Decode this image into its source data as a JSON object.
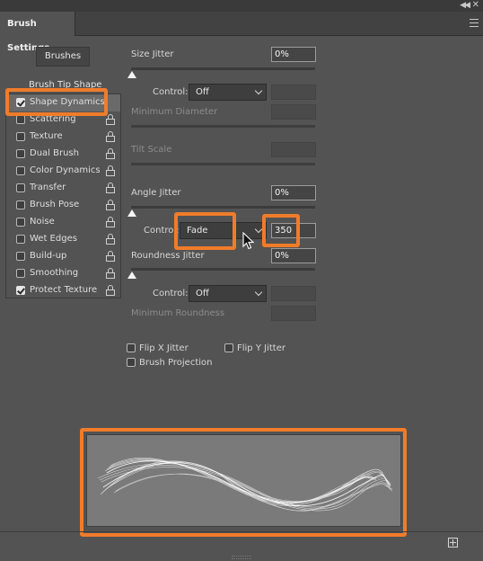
{
  "panel": {
    "tab_title": "Brush Settings",
    "brushes_button": "Brushes",
    "tip_shape": "Brush Tip Shape"
  },
  "sidebar": {
    "items": [
      {
        "label": "Shape Dynamics",
        "checked": true,
        "selected": true
      },
      {
        "label": "Scattering",
        "checked": false
      },
      {
        "label": "Texture",
        "checked": false
      },
      {
        "label": "Dual Brush",
        "checked": false
      },
      {
        "label": "Color Dynamics",
        "checked": false
      },
      {
        "label": "Transfer",
        "checked": false
      },
      {
        "label": "Brush Pose",
        "checked": false
      },
      {
        "label": "Noise",
        "checked": false
      },
      {
        "label": "Wet Edges",
        "checked": false
      },
      {
        "label": "Build-up",
        "checked": false
      },
      {
        "label": "Smoothing",
        "checked": false
      },
      {
        "label": "Protect Texture",
        "checked": true
      }
    ]
  },
  "settings": {
    "size_jitter": {
      "label": "Size Jitter",
      "value": "0%"
    },
    "size_control": {
      "label": "Control:",
      "value": "Off"
    },
    "min_diameter": {
      "label": "Minimum Diameter"
    },
    "tilt_scale": {
      "label": "Tilt Scale"
    },
    "angle_jitter": {
      "label": "Angle Jitter",
      "value": "0%"
    },
    "angle_control": {
      "label": "Control:",
      "value": "Fade",
      "steps": "350"
    },
    "roundness_jitter": {
      "label": "Roundness Jitter",
      "value": "0%"
    },
    "roundness_control": {
      "label": "Control:",
      "value": "Off"
    },
    "min_roundness": {
      "label": "Minimum Roundness"
    },
    "flip_x": {
      "label": "Flip X Jitter",
      "checked": false
    },
    "flip_y": {
      "label": "Flip Y Jitter",
      "checked": false
    },
    "brush_projection": {
      "label": "Brush Projection",
      "checked": false
    }
  },
  "colors": {
    "highlight": "#f07c2a",
    "panel_bg": "#535353",
    "selected_row": "#6a6a6a"
  }
}
